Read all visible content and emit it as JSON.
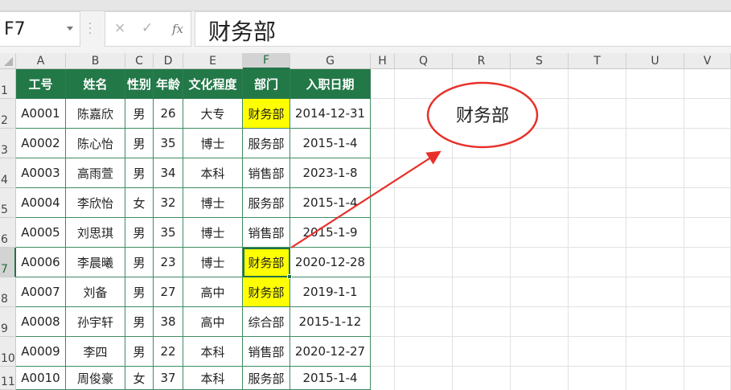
{
  "formula_bar": {
    "name_box": "F7",
    "cancel_icon": "×",
    "enter_icon": "✓",
    "fx_icon": "fx",
    "value": "财务部"
  },
  "column_headers": [
    "A",
    "B",
    "C",
    "D",
    "E",
    "F",
    "G",
    "H",
    "Q",
    "R",
    "S",
    "T",
    "U",
    "V"
  ],
  "row_headers": [
    "1",
    "2",
    "3",
    "4",
    "5",
    "6",
    "7",
    "8",
    "9",
    "10",
    "11"
  ],
  "table": {
    "headers": [
      "工号",
      "姓名",
      "性别",
      "年龄",
      "文化程度",
      "部门",
      "入职日期"
    ],
    "rows": [
      [
        "A0001",
        "陈嘉欣",
        "男",
        "26",
        "大专",
        "财务部",
        "2014-12-31"
      ],
      [
        "A0002",
        "陈心怡",
        "男",
        "35",
        "博士",
        "服务部",
        "2015-1-4"
      ],
      [
        "A0003",
        "高雨萱",
        "男",
        "34",
        "本科",
        "销售部",
        "2023-1-8"
      ],
      [
        "A0004",
        "李欣怡",
        "女",
        "32",
        "博士",
        "服务部",
        "2015-1-4"
      ],
      [
        "A0005",
        "刘思琪",
        "男",
        "35",
        "博士",
        "销售部",
        "2015-1-9"
      ],
      [
        "A0006",
        "李晨曦",
        "男",
        "23",
        "博士",
        "财务部",
        "2020-12-28"
      ],
      [
        "A0007",
        "刘备",
        "男",
        "27",
        "高中",
        "财务部",
        "2019-1-1"
      ],
      [
        "A0008",
        "孙宇轩",
        "男",
        "38",
        "高中",
        "综合部",
        "2015-1-12"
      ],
      [
        "A0009",
        "李四",
        "男",
        "22",
        "本科",
        "销售部",
        "2020-12-27"
      ],
      [
        "A0010",
        "周俊豪",
        "女",
        "37",
        "本科",
        "服务部",
        "2015-1-4"
      ]
    ]
  },
  "selected_cell": "F7",
  "highlight_color": "#ffff00",
  "header_fill_color": "#237848",
  "annotation": {
    "callout_text": "财务部",
    "callout_color": "#e8302a"
  }
}
